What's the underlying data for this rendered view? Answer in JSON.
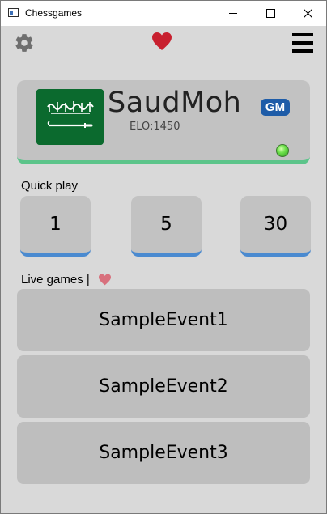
{
  "window": {
    "title": "Chessgames"
  },
  "toolbar": {
    "settings_icon": "gear-icon",
    "favorite_icon": "heart-icon",
    "menu_icon": "hamburger-menu-icon"
  },
  "profile": {
    "name": "SaudMoh",
    "title_badge": "GM",
    "elo": "ELO:1450",
    "flag": "saudi-arabia-flag",
    "status": "online"
  },
  "quick_play": {
    "label": "Quick play",
    "options": [
      "1",
      "5",
      "30"
    ]
  },
  "live_games": {
    "label": "Live games |",
    "events": [
      "SampleEvent1",
      "SampleEvent2",
      "SampleEvent3"
    ]
  },
  "colors": {
    "accent_green": "#5cc48a",
    "accent_blue": "#4a8ad0",
    "heart_red": "#c8202f",
    "badge_blue": "#1e5ca8"
  }
}
